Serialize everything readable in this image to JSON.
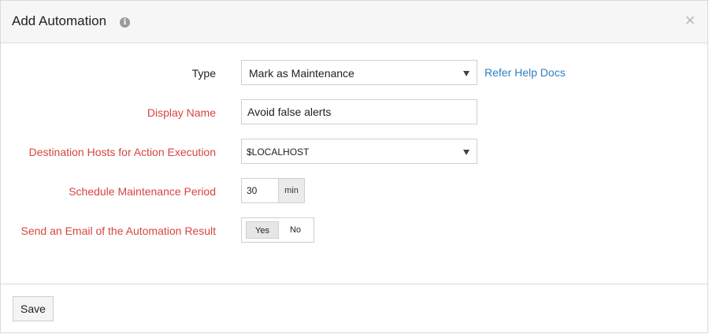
{
  "dialog": {
    "title": "Add Automation",
    "info_icon": "i",
    "close_icon": "×"
  },
  "form": {
    "type": {
      "label": "Type",
      "value": "Mark as Maintenance",
      "help_link": "Refer Help Docs"
    },
    "display_name": {
      "label": "Display Name",
      "value": "Avoid false alerts"
    },
    "destination_hosts": {
      "label": "Destination Hosts for Action Execution",
      "value": "$LOCALHOST"
    },
    "schedule": {
      "label": "Schedule Maintenance Period",
      "value": "30",
      "unit": "min"
    },
    "send_email": {
      "label": "Send an Email of the Automation Result",
      "yes": "Yes",
      "no": "No",
      "selected": "Yes"
    }
  },
  "footer": {
    "save_label": "Save"
  },
  "colors": {
    "required_label": "#d64541",
    "link": "#2f7fc1",
    "header_bg": "#f6f6f6"
  }
}
